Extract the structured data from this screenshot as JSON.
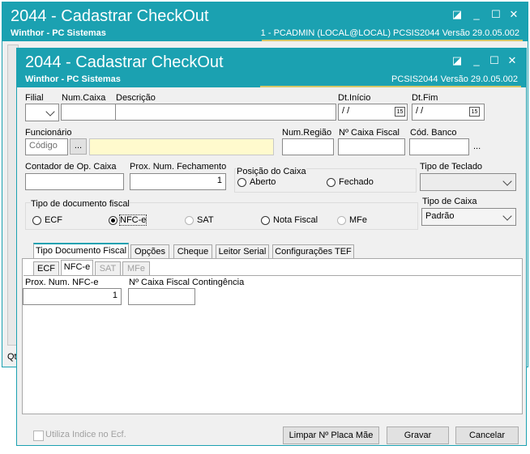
{
  "back_window": {
    "title": "2044 - Cadastrar CheckOut",
    "subtitle": "Winthor - PC Sistemas",
    "status": "1 - PCADMIN (LOCAL@LOCAL)   PCSIS2044  Versão  29.0.05.002",
    "left_fragment": "Qt"
  },
  "window": {
    "title": "2044 - Cadastrar CheckOut",
    "subtitle": "Winthor - PC Sistemas",
    "status": "PCSIS2044  Versão  29.0.05.002"
  },
  "fields": {
    "filial_label": "Filial",
    "numcaixa_label": "Num.Caixa",
    "descricao_label": "Descrição",
    "dtinicio_label": "Dt.Início",
    "dtinicio_value": "/ /",
    "dtfim_label": "Dt.Fim",
    "dtfim_value": "/ /",
    "calendar_badge": "15",
    "funcionario_label": "Funcionário",
    "codigo_placeholder": "Código",
    "lookup_label": "...",
    "numregiao_label": "Num.Região",
    "ncaixafiscal_label": "Nº Caixa Fiscal",
    "codbanco_label": "Cód. Banco",
    "codbanco_lookup": "...",
    "contador_label": "Contador de Op. Caixa",
    "proxnum_label": "Prox. Num. Fechamento",
    "proxnum_value": "1",
    "posicao_label": "Posição do Caixa",
    "aberto_label": "Aberto",
    "fechado_label": "Fechado",
    "teclado_label": "Tipo de Teclado",
    "tipocaixa_label": "Tipo de Caixa",
    "tipocaixa_value": "Padrão"
  },
  "doc_fiscal": {
    "label": "Tipo de documento fiscal",
    "options": [
      "ECF",
      "NFC-e",
      "SAT",
      "Nota Fiscal",
      "MFe"
    ],
    "selected": "NFC-e"
  },
  "tabs": [
    "Tipo Documento Fiscal",
    "Opções",
    "Cheque",
    "Leitor Serial",
    "Configurações TEF"
  ],
  "subtabs": [
    "ECF",
    "NFC-e",
    "SAT",
    "MFe"
  ],
  "nfce": {
    "proxnum_label": "Prox. Num. NFC-e",
    "proxnum_value": "1",
    "contingencia_label": "Nº Caixa Fiscal Contingência"
  },
  "footer": {
    "checkbox_label": "Utiliza Indice no Ecf.",
    "limpar_label": "Limpar Nº Placa Mãe",
    "gravar_label": "Gravar",
    "cancelar_label": "Cancelar"
  }
}
